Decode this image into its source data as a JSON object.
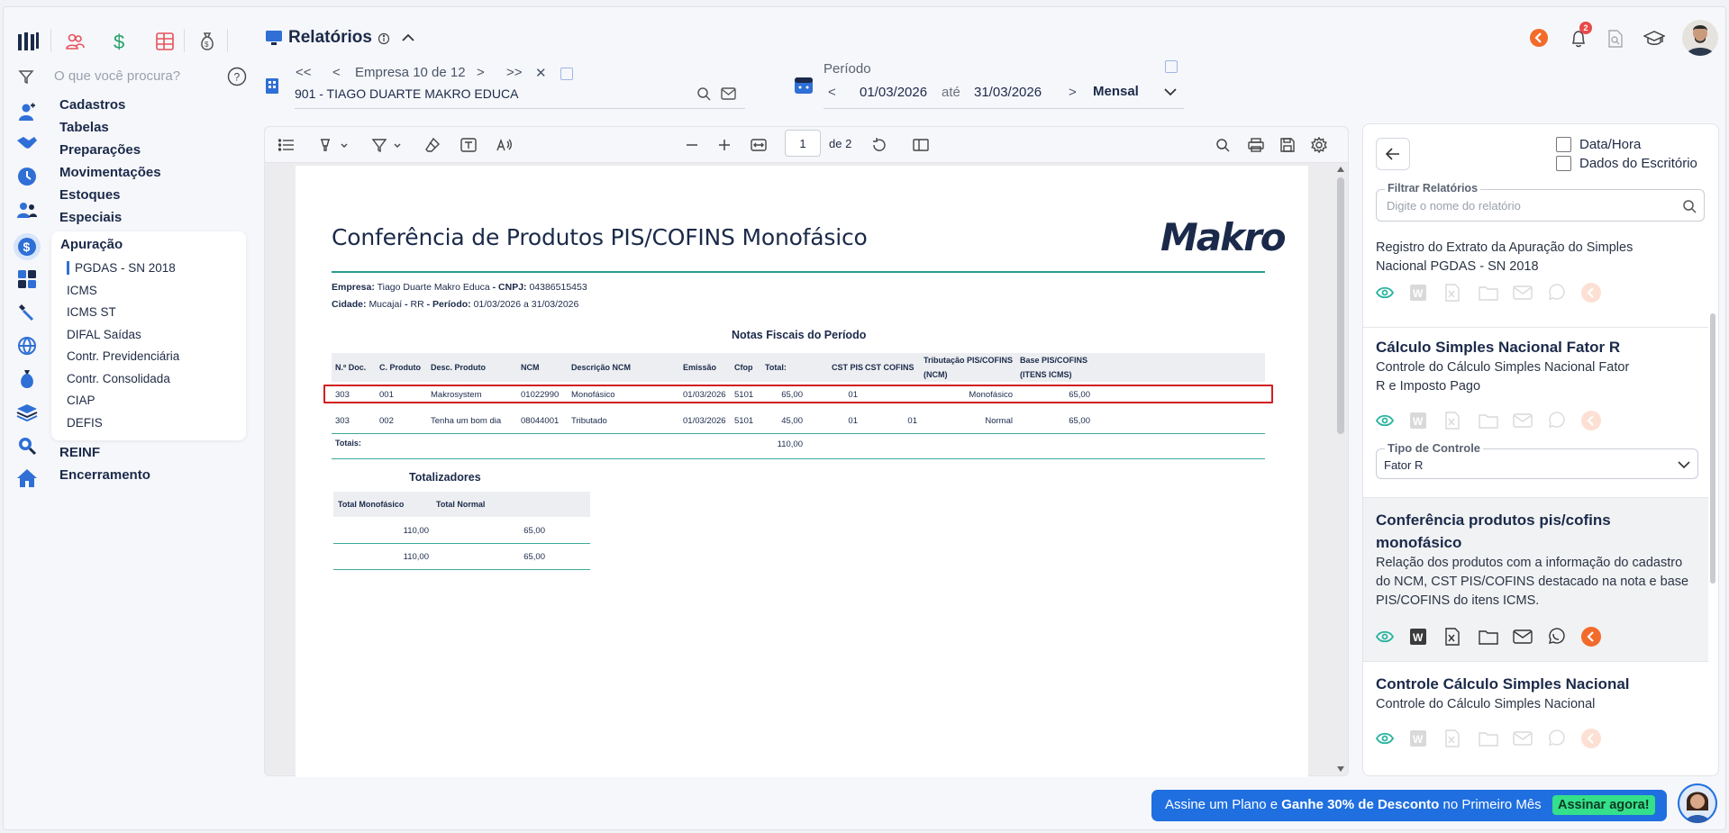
{
  "header": {
    "title": "Relatórios",
    "nav_first": "<<",
    "nav_prev": "<",
    "empresa_label": "Empresa 10 de 12",
    "nav_next": ">",
    "nav_last": ">>",
    "close": "✕",
    "company": "901 - TIAGO DUARTE MAKRO EDUCA",
    "periodo_label": "Período",
    "date_from": "01/03/2026",
    "ate": "até",
    "date_to": "31/03/2026",
    "frequency": "Mensal",
    "notifications_count": "2"
  },
  "sidebar": {
    "search_placeholder": "O que você procura?",
    "items": [
      {
        "label": "Cadastros",
        "icon": "user-plus-icon"
      },
      {
        "label": "Tabelas",
        "icon": "handshake-icon"
      },
      {
        "label": "Preparações",
        "icon": "clock-icon"
      },
      {
        "label": "Movimentações",
        "icon": "users-icon"
      },
      {
        "label": "Estoques",
        "icon": "dollar-circle-icon"
      },
      {
        "label": "Especiais",
        "icon": "grid-icon"
      }
    ],
    "submenu_title": "Apuração",
    "submenu": [
      "PGDAS - SN 2018",
      "ICMS",
      "ICMS ST",
      "DIFAL Saídas",
      "Contr. Previdenciária",
      "Contr. Consolidada",
      "CIAP",
      "DEFIS"
    ],
    "after_items": [
      "REINF",
      "Encerramento"
    ]
  },
  "viewer": {
    "page_current": "1",
    "page_of": "de 2"
  },
  "document": {
    "title": "Conferência de Produtos PIS/COFINS Monofásico",
    "logo": "Makro",
    "empresa_label": "Empresa:",
    "empresa_value": "Tiago Duarte Makro Educa",
    "cnpj_label": "- CNPJ:",
    "cnpj_value": "04386515453",
    "cidade_label": "Cidade:",
    "cidade_value": "Mucajaí",
    "uf_sep": "-",
    "uf_value": "RR",
    "periodo_label": "- Período:",
    "periodo_value": "01/03/2026 a 31/03/2026",
    "section_title": "Notas Fiscais do Período",
    "columns": [
      "N.º Doc.",
      "C. Produto",
      "Desc. Produto",
      "NCM",
      "Descrição NCM",
      "Emissão",
      "Cfop",
      "Total:",
      "CST PIS",
      "CST COFINS",
      "Tributação PIS/COFINS (NCM)",
      "Base PIS/COFINS (ITENS ICMS)"
    ],
    "rows": [
      [
        "303",
        "001",
        "Makrosystem",
        "01022990",
        "Monofásico",
        "01/03/2026",
        "5101",
        "65,00",
        "01",
        "",
        "Monofásico",
        "65,00"
      ],
      [
        "303",
        "002",
        "Tenha um bom dia",
        "08044001",
        "Tributado",
        "01/03/2026",
        "5101",
        "45,00",
        "01",
        "01",
        "Normal",
        "65,00"
      ]
    ],
    "totais_label": "Totais:",
    "totais_value": "110,00",
    "totalizadores_title": "Totalizadores",
    "totalizadores_cols": [
      "Total Monofásico",
      "Total Normal"
    ],
    "totalizadores_rows": [
      [
        "110,00",
        "65,00"
      ],
      [
        "110,00",
        "65,00"
      ]
    ]
  },
  "right_panel": {
    "check_datahora": "Data/Hora",
    "check_escritorio": "Dados do Escritório",
    "filter_label": "Filtrar Relatórios",
    "filter_placeholder": "Digite o nome do relatório",
    "cards": [
      {
        "title": "",
        "desc": "Registro do Extrato da Apuração do Simples Nacional PGDAS - SN 2018"
      },
      {
        "title": "Cálculo Simples Nacional Fator R",
        "desc": "Controle do Cálculo Simples Nacional Fator R e Imposto Pago",
        "select_label": "Tipo de Controle",
        "select_value": "Fator R"
      },
      {
        "title": "Conferência produtos pis/cofins monofásico",
        "desc": "Relação dos produtos com a informação do cadastro do NCM, CST PIS/COFINS destacado na nota e base PIS/COFINS do itens ICMS."
      },
      {
        "title": "Controle Cálculo Simples Nacional",
        "desc": "Controle do Cálculo Simples Nacional"
      }
    ]
  },
  "banner": {
    "pre": "Assine um Plano e ",
    "bold": "Ganhe 30% de Desconto",
    "post": " no Primeiro Mês",
    "cta": "Assinar agora!"
  },
  "colors": {
    "accent": "#1f6fe0",
    "highlight": "#d11f1f",
    "teal": "#2a9d8f",
    "orange": "#f26b2a"
  }
}
